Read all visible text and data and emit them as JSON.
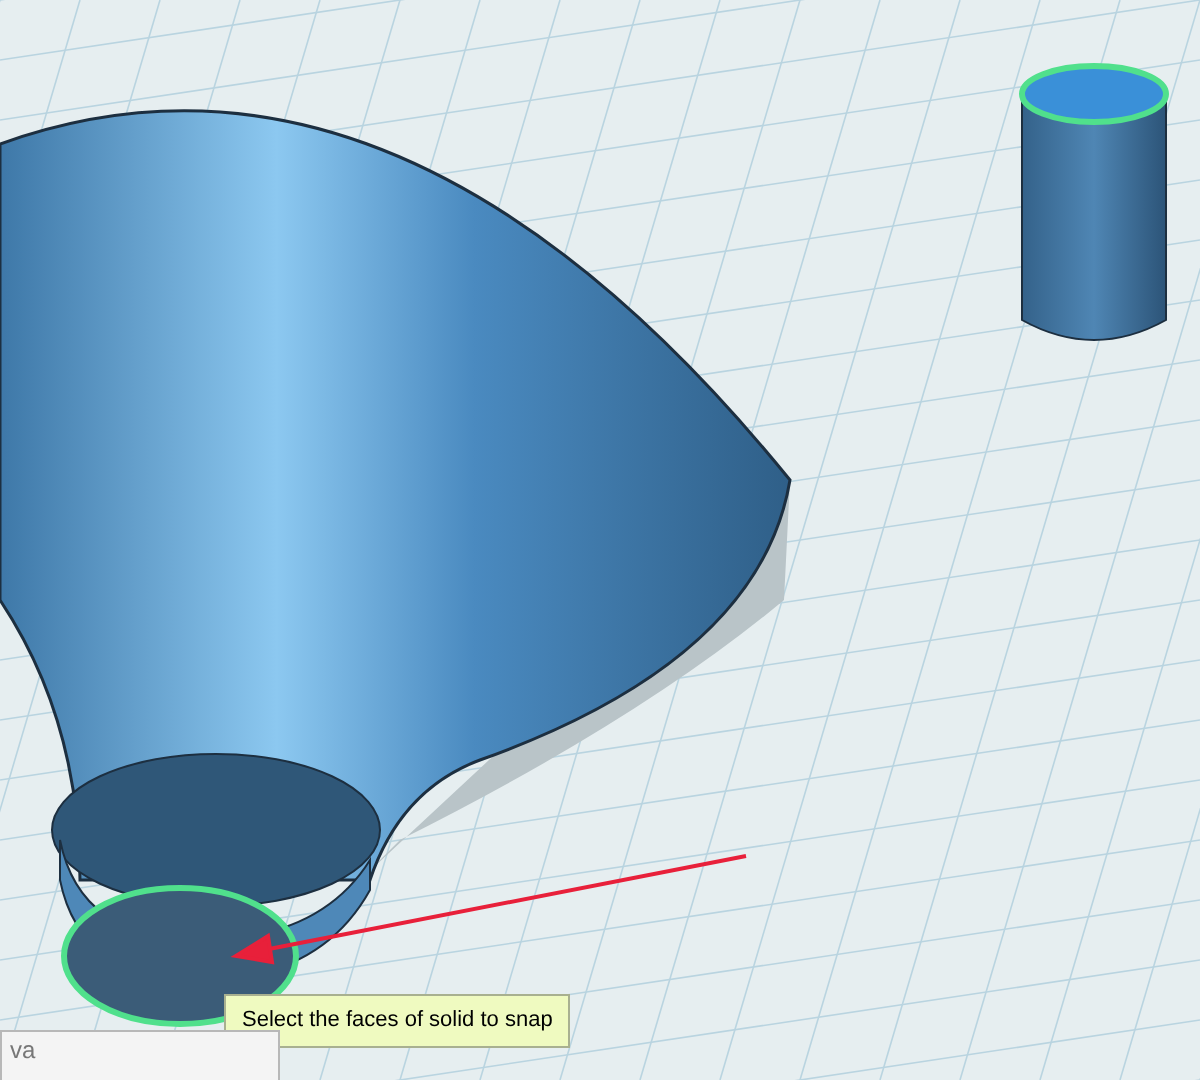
{
  "tooltip": {
    "text": "Select the faces of solid to snap"
  },
  "panel": {
    "title": "va"
  }
}
